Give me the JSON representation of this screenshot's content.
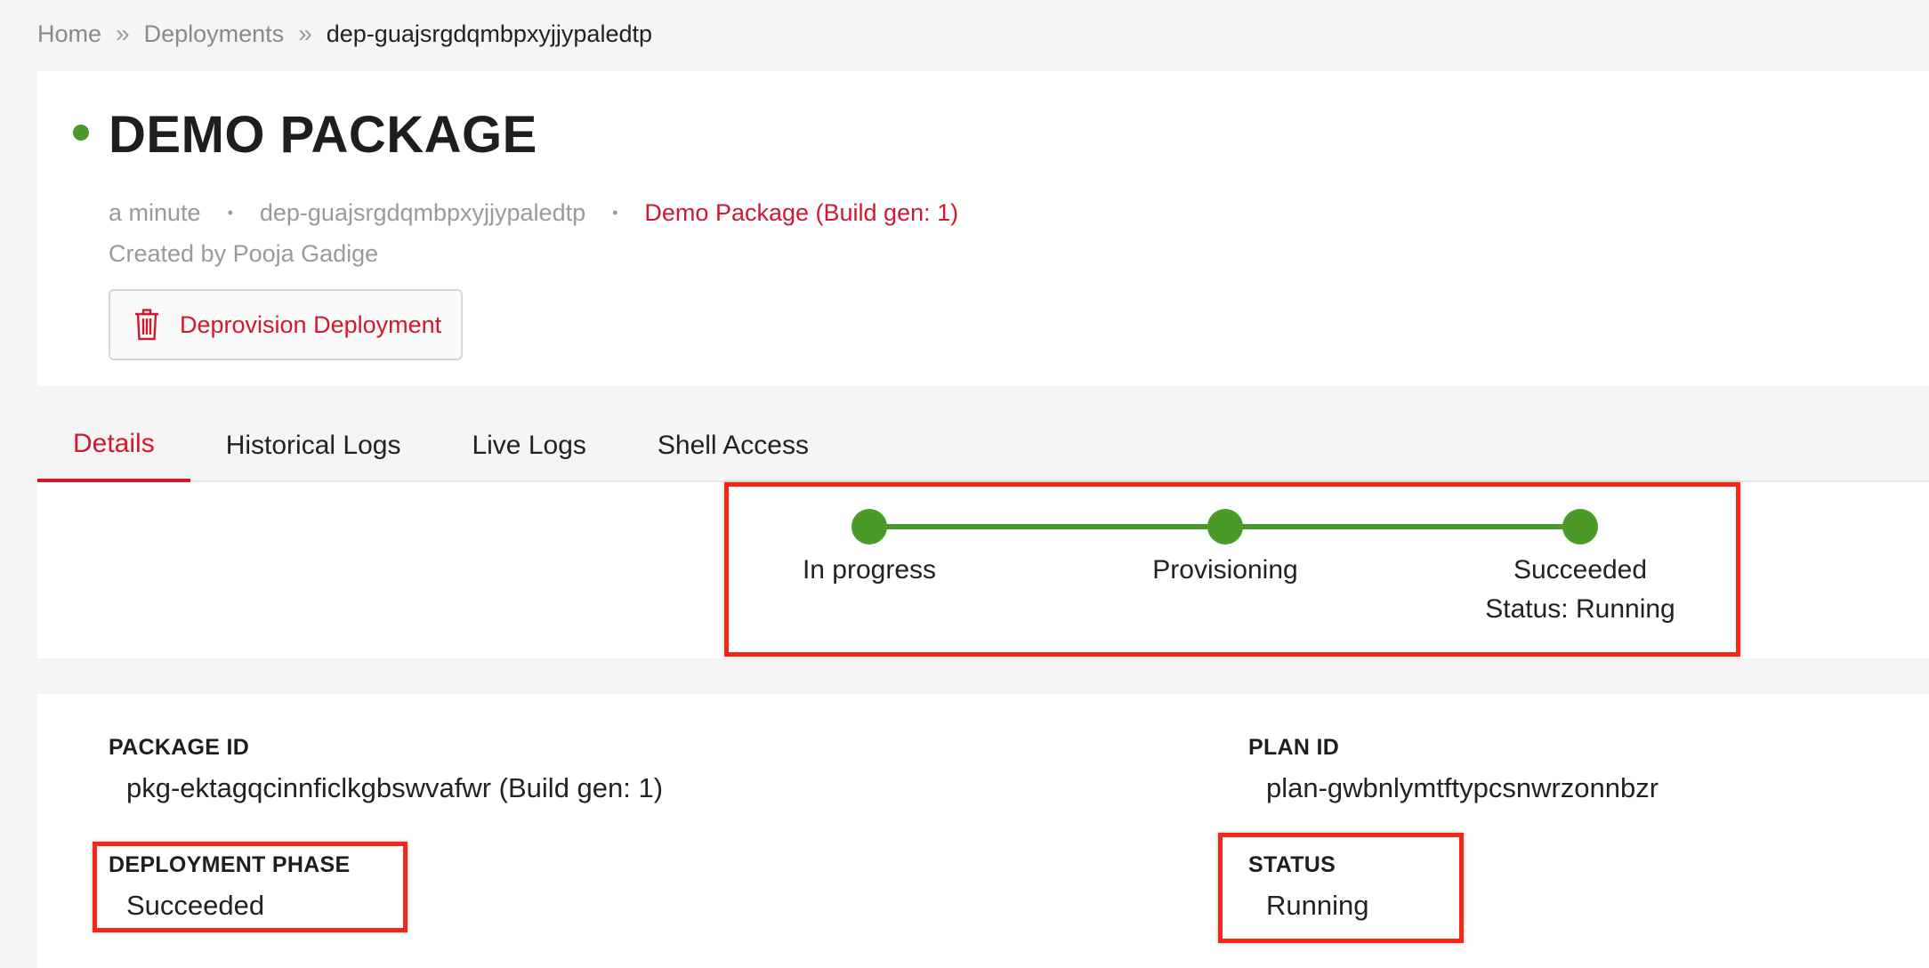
{
  "breadcrumb": {
    "home": "Home",
    "deployments": "Deployments",
    "current": "dep-guajsrgdqmbpxyjjypaledtp",
    "separator": "»"
  },
  "header": {
    "title": "DEMO PACKAGE",
    "age": "a minute",
    "deployment_id": "dep-guajsrgdqmbpxyjjypaledtp",
    "package_link": "Demo Package (Build gen: 1)",
    "created_by": "Created by Pooja Gadige",
    "deprovision_label": "Deprovision Deployment",
    "status_color": "#4a9a2a"
  },
  "tabs": [
    {
      "label": "Details",
      "active": true
    },
    {
      "label": "Historical Logs",
      "active": false
    },
    {
      "label": "Live Logs",
      "active": false
    },
    {
      "label": "Shell Access",
      "active": false
    }
  ],
  "progress": {
    "steps": [
      {
        "label": "In progress"
      },
      {
        "label": "Provisioning"
      },
      {
        "label": "Succeeded",
        "sublabel": "Status: Running"
      }
    ],
    "color": "#4a9a2a"
  },
  "details": {
    "package_id_label": "PACKAGE ID",
    "package_id_value": "pkg-ektagqcinnficlkgbswvafwr (Build gen: 1)",
    "plan_id_label": "PLAN ID",
    "plan_id_value": "plan-gwbnlymtftypcsnwrzonnbzr",
    "phase_label": "DEPLOYMENT PHASE",
    "phase_value": "Succeeded",
    "status_label": "STATUS",
    "status_value": "Running"
  },
  "colors": {
    "accent": "#d0192e",
    "highlight": "#f2261a"
  }
}
